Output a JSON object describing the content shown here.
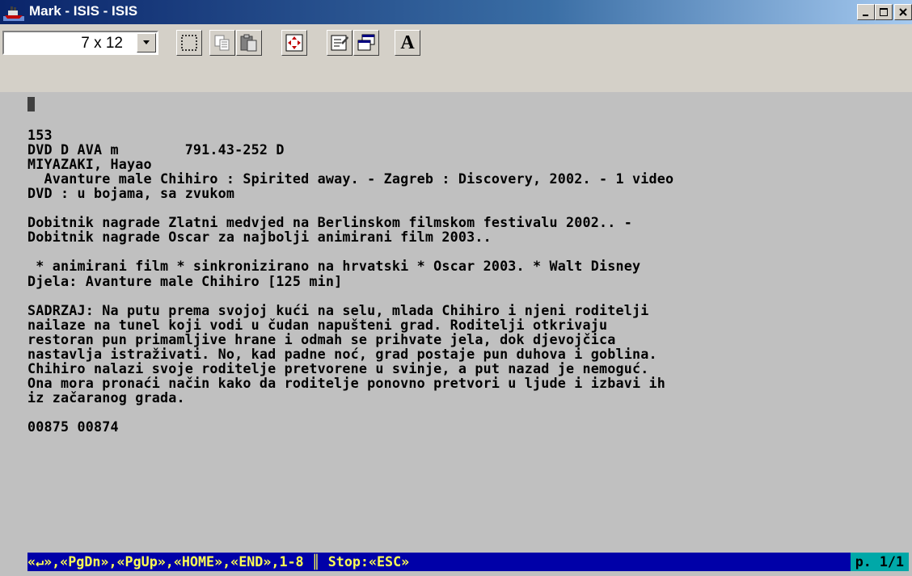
{
  "window": {
    "title": "Mark - ISIS - ISIS",
    "controls": [
      "minimize-icon",
      "maximize-icon",
      "close-icon"
    ]
  },
  "toolbar": {
    "font_size_value": "7 x 12",
    "buttons": [
      "select-icon",
      "copy-icon",
      "paste-icon",
      "fullscreen-icon",
      "properties-icon",
      "background-icon",
      "font-icon"
    ],
    "font_button_label": "A"
  },
  "record": {
    "lines": [
      "153",
      "DVD D AVA m        791.43-252 D",
      "MIYAZAKI, Hayao",
      "  Avanture male Chihiro : Spirited away. - Zagreb : Discovery, 2002. - 1 video",
      "DVD : u bojama, sa zvukom",
      "",
      "Dobitnik nagrade Zlatni medvjed na Berlinskom filmskom festivalu 2002.. -",
      "Dobitnik nagrade Oscar za najbolji animirani film 2003..",
      "",
      " * animirani film * sinkronizirano na hrvatski * Oscar 2003. * Walt Disney",
      "Djela: Avanture male Chihiro [125 min]",
      "",
      "SADRZAJ: Na putu prema svojoj kući na selu, mlada Chihiro i njeni roditelji",
      "nailaze na tunel koji vodi u čudan napušteni grad. Roditelji otkrivaju",
      "restoran pun primamljive hrane i odmah se prihvate jela, dok djevojčica",
      "nastavlja istraživati. No, kad padne noć, grad postaje pun duhova i goblina.",
      "Chihiro nalazi svoje roditelje pretvorene u svinje, a put nazad je nemoguć.",
      "Ona mora pronaći način kako da roditelje ponovno pretvori u ljude i izbavi ih",
      "iz začaranog grada.",
      "",
      "00875 00874"
    ]
  },
  "status": {
    "keys": "«↵»,«PgDn»,«PgUp»,«HOME»,«END»,1-8 ║ Stop:«ESC»",
    "page": "p. 1/1"
  },
  "colors": {
    "title_bar": "#0a246a",
    "terminal_bg": "#c0c0c0",
    "status_bg": "#0000a8",
    "status_fg": "#ffff54",
    "page_bg": "#00a8a8"
  }
}
